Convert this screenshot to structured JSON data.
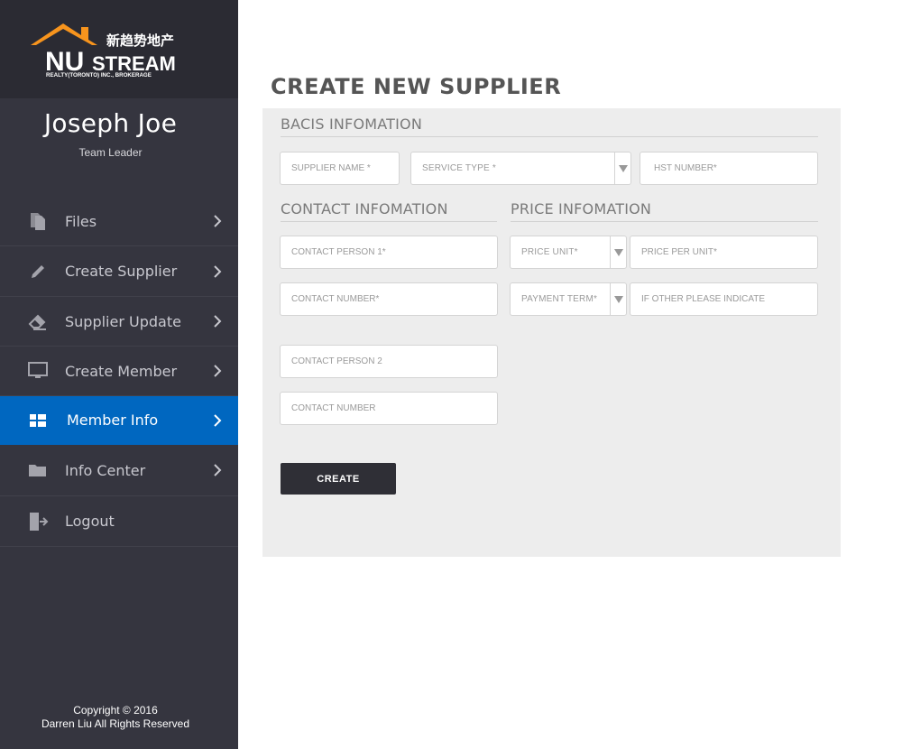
{
  "brand": {
    "name_primary": "NU",
    "name_secondary": "STREAM",
    "chinese": "新趋势地产",
    "tagline": "REALTY(TORONTO) INC., BROKERAGE",
    "accent": "#f7941d"
  },
  "user": {
    "name": "Joseph Joe",
    "role": "Team Leader"
  },
  "nav": {
    "items": [
      {
        "label": "Files",
        "icon": "files-icon",
        "chevron": true
      },
      {
        "label": "Create Supplier",
        "icon": "pencil-icon",
        "chevron": true
      },
      {
        "label": "Supplier Update",
        "icon": "eraser-icon",
        "chevron": true
      },
      {
        "label": "Create Member",
        "icon": "monitor-icon",
        "chevron": true
      },
      {
        "label": "Member Info",
        "icon": "grid-icon",
        "chevron": true,
        "active": true
      },
      {
        "label": "Info Center",
        "icon": "folder-icon",
        "chevron": true
      },
      {
        "label": "Logout",
        "icon": "logout-icon",
        "chevron": false
      }
    ],
    "active_color": "#0067c0"
  },
  "copyright": {
    "line1": "Copyright © 2016",
    "line2": "Darren Liu All Rights Reserved"
  },
  "page": {
    "title": "CREATE NEW SUPPLIER"
  },
  "form": {
    "basic": {
      "title": "BACIS INFOMATION",
      "supplier_name_placeholder": "SUPPLIER NAME *",
      "service_type_placeholder": "SERVICE TYPE *",
      "hst_number_placeholder": "HST NUMBER*"
    },
    "contact": {
      "title": "CONTACT INFOMATION",
      "contact_person1_placeholder": "CONTACT PERSON 1*",
      "contact_number1_placeholder": "CONTACT NUMBER*",
      "contact_person2_placeholder": "CONTACT PERSON 2",
      "contact_number2_placeholder": "CONTACT NUMBER"
    },
    "price": {
      "title": "PRICE INFOMATION",
      "price_unit_placeholder": "PRICE UNIT*",
      "price_per_unit_placeholder": "PRICE PER UNIT*",
      "payment_term_placeholder": "PAYMENT TERM*",
      "other_placeholder": "IF OTHER PLEASE INDICATE"
    },
    "submit_label": "CREATE"
  }
}
